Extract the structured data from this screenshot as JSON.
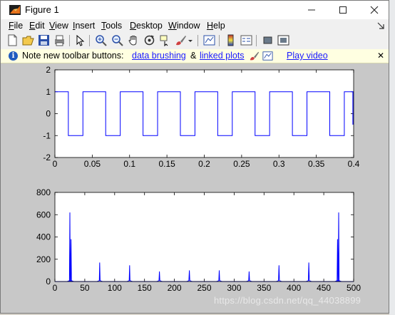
{
  "window": {
    "title": "Figure 1"
  },
  "menu": [
    "File",
    "Edit",
    "View",
    "Insert",
    "Tools",
    "Desktop",
    "Window",
    "Help"
  ],
  "menu_underline": [
    "F",
    "E",
    "V",
    "I",
    "T",
    "D",
    "W",
    "H"
  ],
  "infobar": {
    "text": "Note new toolbar buttons:",
    "link1": "data brushing",
    "amp": "&",
    "link2": "linked plots",
    "link3": "Play video"
  },
  "colors": {
    "line": "#0000ff",
    "figure_bg": "#c8c8c8",
    "axes_bg": "#ffffff",
    "info_bg": "#ffffe1"
  },
  "watermark": "https://blog.csdn.net/qq_44038899",
  "chart_data": [
    {
      "type": "line",
      "description_key": "square wave, period 0.05, duty ~60%",
      "x_ticks": [
        "0",
        "0.05",
        "0.1",
        "0.15",
        "0.2",
        "0.25",
        "0.3",
        "0.35",
        "0.4"
      ],
      "y_ticks": [
        "-2",
        "-1",
        "0",
        "1",
        "2"
      ],
      "xlim": [
        0,
        0.4
      ],
      "ylim": [
        -2,
        2
      ],
      "levels": [
        1,
        -1
      ],
      "period": 0.05,
      "high_start": [
        0,
        0.0375,
        0.0875,
        0.1375,
        0.1875,
        0.2375,
        0.2875,
        0.3375,
        0.3875
      ],
      "high_end": [
        0.018,
        0.068,
        0.118,
        0.168,
        0.218,
        0.268,
        0.318,
        0.368,
        0.4
      ]
    },
    {
      "type": "line",
      "x_ticks": [
        "0",
        "50",
        "100",
        "150",
        "200",
        "250",
        "300",
        "350",
        "400",
        "450",
        "500"
      ],
      "y_ticks": [
        "0",
        "200",
        "400",
        "600",
        "800"
      ],
      "xlim": [
        0,
        500
      ],
      "ylim": [
        0,
        800
      ],
      "peaks": [
        {
          "x": 25,
          "y": 620
        },
        {
          "x": 27,
          "y": 380
        },
        {
          "x": 75,
          "y": 170
        },
        {
          "x": 125,
          "y": 145
        },
        {
          "x": 175,
          "y": 90
        },
        {
          "x": 225,
          "y": 100
        },
        {
          "x": 275,
          "y": 100
        },
        {
          "x": 325,
          "y": 90
        },
        {
          "x": 375,
          "y": 145
        },
        {
          "x": 425,
          "y": 170
        },
        {
          "x": 473,
          "y": 380
        },
        {
          "x": 475,
          "y": 620
        }
      ]
    }
  ]
}
